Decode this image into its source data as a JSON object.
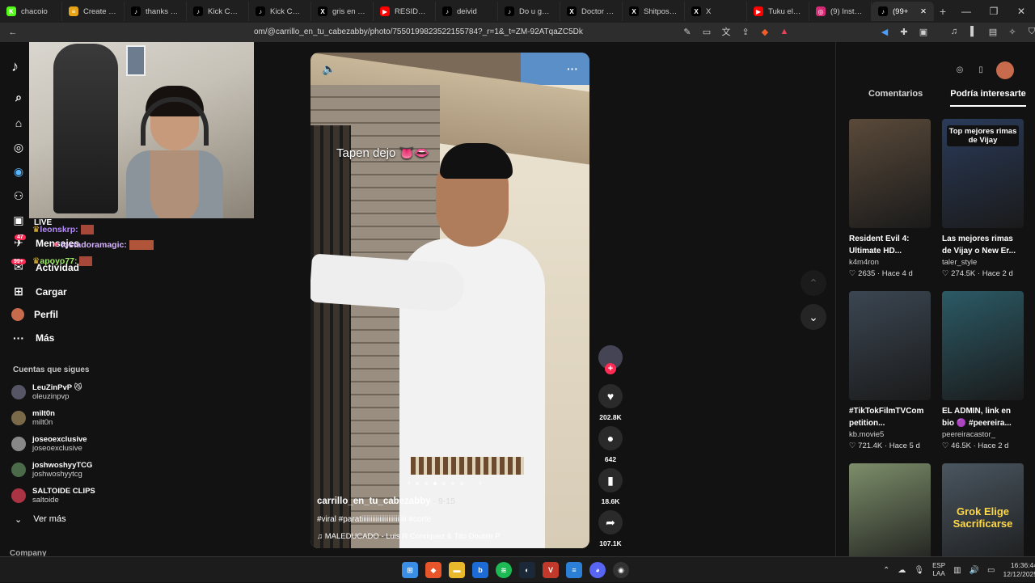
{
  "browser": {
    "tabs": [
      {
        "label": "chacoio",
        "fav": "K",
        "color": "#53fc18"
      },
      {
        "label": "Create a Sp",
        "fav": "≡",
        "color": "#e8a317"
      },
      {
        "label": "thanks to th",
        "fav": "♪",
        "color": "#000000"
      },
      {
        "label": "Kick Chat O",
        "fav": "♪",
        "color": "#000000"
      },
      {
        "label": "Kick Chat O",
        "fav": "♪",
        "color": "#000000"
      },
      {
        "label": "gris en X: \"",
        "fav": "X",
        "color": "#000000"
      },
      {
        "label": "RESIDENT E",
        "fav": "▶",
        "color": "#ff0000"
      },
      {
        "label": "deivid",
        "fav": "♪",
        "color": "#000000"
      },
      {
        "label": "Do u get th",
        "fav": "♪",
        "color": "#000000"
      },
      {
        "label": "Doctor Mar",
        "fav": "X",
        "color": "#000000"
      },
      {
        "label": "Shitpost 20",
        "fav": "X",
        "color": "#000000"
      },
      {
        "label": "X",
        "fav": "X",
        "color": "#000000"
      },
      {
        "label": "Tuku el Car",
        "fav": "▶",
        "color": "#ff0000"
      },
      {
        "label": "(9) Instagra",
        "fav": "◎",
        "color": "#d62976"
      },
      {
        "label": "(99+",
        "fav": "♪",
        "color": "#000000",
        "active": true
      }
    ],
    "url": "om/@carrillo_en_tu_cabezabby/photo/7550199823522155784?_r=1&_t=ZM-92ATqaZC5Dk"
  },
  "nav": {
    "logo": "♪",
    "items": [
      {
        "label": "LIVE",
        "icon": "▣"
      },
      {
        "label": "Mensajes",
        "icon": "✈"
      },
      {
        "label": "Actividad",
        "icon": "✉"
      },
      {
        "label": "Cargar",
        "icon": "⊞"
      },
      {
        "label": "Perfil",
        "icon": "●"
      },
      {
        "label": "Más",
        "icon": "···"
      }
    ],
    "badges": [
      "47",
      "99+"
    ],
    "follows_title": "Cuentas que sigues",
    "follows": [
      {
        "name": "LeuZinPvP 😼",
        "handle": "oleuzinpvp"
      },
      {
        "name": "milt0n",
        "handle": "milt0n"
      },
      {
        "name": "joseoexclusive",
        "handle": "joseoexclusive"
      },
      {
        "name": "joshwoshyyTCG",
        "handle": "joshwoshyytcg"
      },
      {
        "name": "SALTOIDE CLIPS",
        "handle": "saltoide"
      }
    ],
    "ver_mas": "Ver más",
    "company": "Company"
  },
  "chat": [
    {
      "user": "leonskrp:",
      "color": "#b68bff"
    },
    {
      "user": "tostadoramagic:",
      "color": "#d7b3ff"
    },
    {
      "user": "apoyo77:",
      "color": "#9ee86a"
    }
  ],
  "video": {
    "caption": "Tapen dejo 👅👄",
    "author": "carrillo_en_tu_cabezabby",
    "date": " · 9-15",
    "tags": "#viral #paratiiiiiiiiiiiiiiiiiiiiiiiii #corte",
    "music": "♫  MALEDUCADO - Luis R Conriquez & Tito Double P",
    "likes": "202.8K",
    "comments": "642",
    "saves": "18.6K",
    "shares": "107.1K"
  },
  "right": {
    "tabs": [
      "Comentarios",
      "Podría interesarte"
    ],
    "cards": [
      {
        "title": "Resident Evil 4: Ultimate HD...",
        "author": "k4m4ron",
        "meta": "♡ 2635 · Hace 4 d",
        "thumb_color": "#5a4a3a"
      },
      {
        "title": "Las mejores rimas de Vijay o New Er...",
        "author": "taler_style",
        "meta": "♡ 274.5K · Hace 2 d",
        "thumb_color": "#2a3b5a",
        "overlay": "Top mejores rimas de Vijay"
      },
      {
        "title": "#TikTokFilmTVCom petition...",
        "author": "kb.movie5",
        "meta": "♡ 721.4K · Hace 5 d",
        "thumb_color": "#3b4652"
      },
      {
        "title": "EL ADMIN, link en bio 🟣 #peereira...",
        "author": "peereiracastor_",
        "meta": "♡ 46.5K · Hace 2 d",
        "thumb_color": "#2b5a66"
      },
      {
        "title": "",
        "author": "",
        "meta": "",
        "thumb_color": "#7d8e6a"
      },
      {
        "title": "",
        "author": "",
        "meta": "",
        "thumb_color": "#4a5660",
        "overlay": "Grok Elige Sacrificarse"
      }
    ]
  },
  "taskbar": {
    "lang": "ESP",
    "lang2": "LAA",
    "time": "16:36:44",
    "date": "12/12/2025"
  }
}
